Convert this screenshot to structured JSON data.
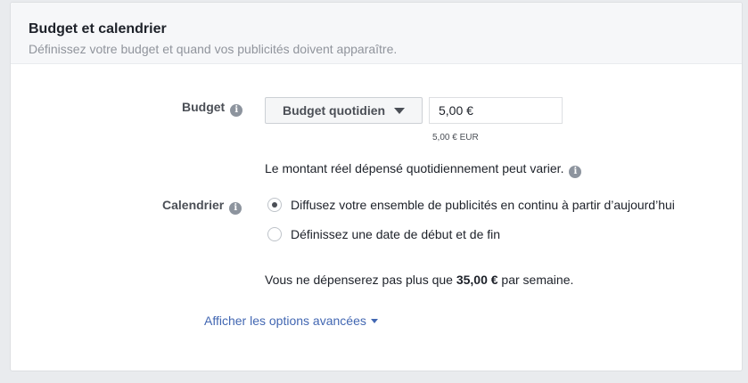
{
  "section": {
    "title": "Budget et calendrier",
    "subtitle": "Définissez votre budget et quand vos publicités doivent apparaître."
  },
  "budget": {
    "label": "Budget",
    "type_label": "Budget quotidien",
    "amount_value": "5,00 €",
    "amount_note": "5,00 € EUR",
    "variation_note": "Le montant réel dépensé quotidiennement peut varier."
  },
  "schedule": {
    "label": "Calendrier",
    "options": [
      {
        "label": "Diffusez votre ensemble de publicités en continu à partir d’aujourd’hui",
        "selected": true
      },
      {
        "label": "Définissez une date de début et de fin",
        "selected": false
      }
    ]
  },
  "spend_summary": {
    "prefix": "Vous ne dépenserez pas plus que ",
    "amount": "35,00 €",
    "suffix": " par semaine."
  },
  "advanced_link": {
    "label": "Afficher les options avancées"
  },
  "icons": {
    "info": "info-icon",
    "dropdown": "caret-down-icon"
  },
  "colors": {
    "link": "#4267b2",
    "muted_text": "#90949c",
    "label_text": "#4b4f56"
  }
}
